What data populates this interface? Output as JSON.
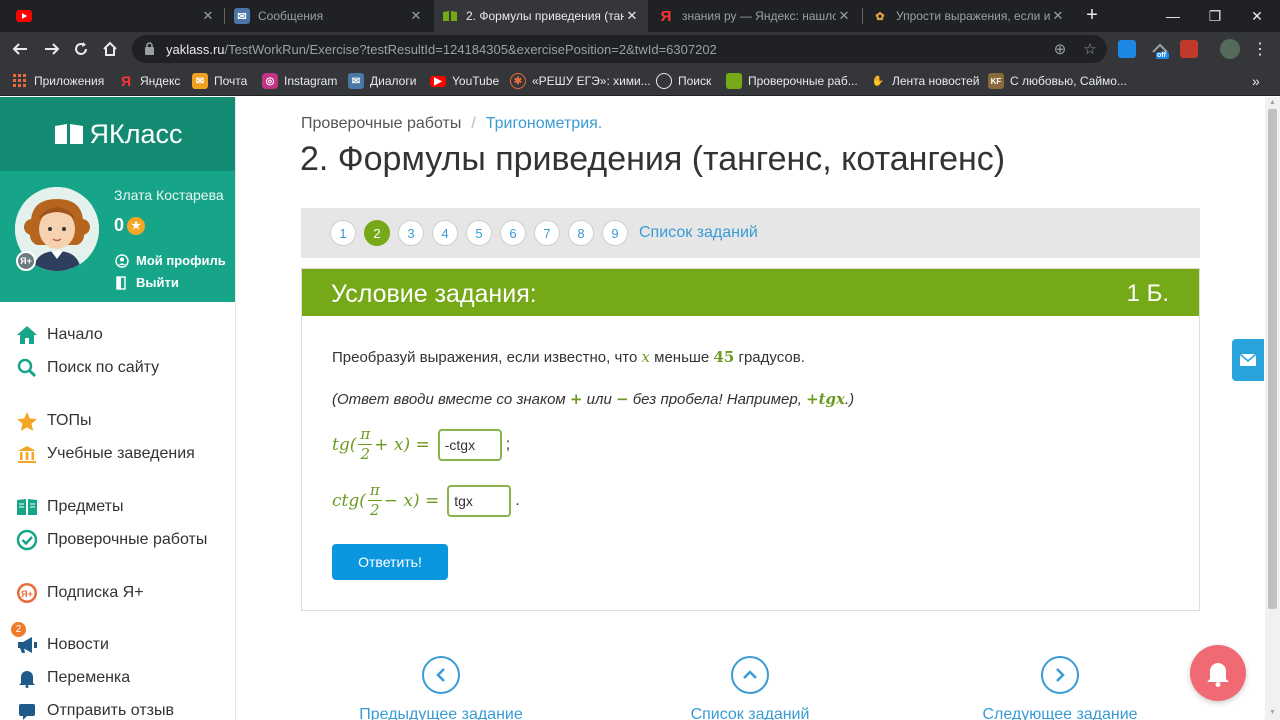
{
  "browser": {
    "tabs": [
      {
        "title": "",
        "icon": "youtube-favicon"
      },
      {
        "title": "Сообщения",
        "icon": "vk-messages-favicon"
      },
      {
        "title": "2. Формулы приведения (тан",
        "icon": "yaklass-favicon",
        "active": true
      },
      {
        "title": "знания ру — Яндекс: нашлос",
        "icon": "yandex-favicon"
      },
      {
        "title": "Упрости выражения, если из",
        "icon": "znanija-favicon"
      }
    ],
    "address": {
      "host": "yaklass.ru",
      "path": "/TestWorkRun/Exercise?testResultId=124184305&exercisePosition=2&twId=6307202"
    },
    "bookmarks": [
      {
        "label": "Приложения",
        "icon": "apps-grid-icon"
      },
      {
        "label": "Яндекс",
        "icon": "yandex-icon"
      },
      {
        "label": "Почта",
        "icon": "mail-icon"
      },
      {
        "label": "Instagram",
        "icon": "instagram-icon"
      },
      {
        "label": "Диалоги",
        "icon": "vk-dialogs-icon"
      },
      {
        "label": "YouTube",
        "icon": "youtube-icon"
      },
      {
        "label": "«РЕШУ ЕГЭ»: хими...",
        "icon": "reshu-ege-icon"
      },
      {
        "label": "Поиск",
        "icon": "globe-icon"
      },
      {
        "label": "Проверочные раб...",
        "icon": "yaklass-book-icon"
      },
      {
        "label": "Лента новостей",
        "icon": "news-feed-icon"
      },
      {
        "label": "С любовью, Саймо...",
        "icon": "kf-icon"
      }
    ],
    "ext_badge": "off"
  },
  "sidebar": {
    "logo": "ЯКласс",
    "user": {
      "name": "Злата Костарева",
      "points": "0",
      "profile_link": "Мой профиль",
      "logout_link": "Выйти",
      "avatar_badge": "Я+"
    },
    "menu": [
      {
        "label": "Начало",
        "icon": "home-icon"
      },
      {
        "label": "Поиск по сайту",
        "icon": "search-icon"
      },
      {
        "label": "ТОПы",
        "icon": "star-icon"
      },
      {
        "label": "Учебные заведения",
        "icon": "institution-icon"
      },
      {
        "label": "Предметы",
        "icon": "book-icon"
      },
      {
        "label": "Проверочные работы",
        "icon": "check-circle-icon",
        "badge": "2"
      },
      {
        "label": "Подписка Я+",
        "icon": "ya-plus-icon"
      },
      {
        "label": "Новости",
        "icon": "megaphone-icon"
      },
      {
        "label": "Переменка",
        "icon": "bell-icon"
      },
      {
        "label": "Отправить отзыв",
        "icon": "feedback-icon"
      }
    ]
  },
  "main": {
    "breadcrumb": {
      "root": "Проверочные работы",
      "separator": "/",
      "current": "Тригонометрия."
    },
    "title": "2. Формулы приведения (тангенс, котангенс)",
    "pager": {
      "pages": [
        "1",
        "2",
        "3",
        "4",
        "5",
        "6",
        "7",
        "8",
        "9"
      ],
      "current": "2",
      "task_list_link": "Список заданий"
    },
    "task": {
      "header": "Условие задания:",
      "points": "1 Б.",
      "statement_before": "Преобразуй выражения, если известно, что ",
      "statement_var": "x",
      "statement_mid": " меньше ",
      "statement_num": "45",
      "statement_after": " градусов.",
      "hint_before": "(Ответ вводи вместе со знаком ",
      "hint_plus": "+",
      "hint_or": " или ",
      "hint_minus": "−",
      "hint_mid": " без пробела! Например, ",
      "hint_example": "+tgx",
      "hint_after": ".)",
      "formula1": {
        "fn": "tg(",
        "num": "π",
        "den": "2",
        "rest": "+ x) =",
        "answer": "-ctgx",
        "punct": ";"
      },
      "formula2": {
        "fn": "ctg(",
        "num": "π",
        "den": "2",
        "rest": "− x) =",
        "answer": "tgx",
        "punct": "."
      },
      "submit": "Ответить!"
    },
    "bottom_nav": {
      "prev": "Предыдущее задание",
      "list": "Список заданий",
      "next": "Следующее задание"
    }
  },
  "colors": {
    "sidebar_logo_bg": "#138a72",
    "sidebar_user_bg": "#17a589",
    "task_header_bg": "#76a917",
    "submit_bg": "#0a97e0",
    "link": "#3a9bd5",
    "bell_bg": "#f06a74"
  }
}
